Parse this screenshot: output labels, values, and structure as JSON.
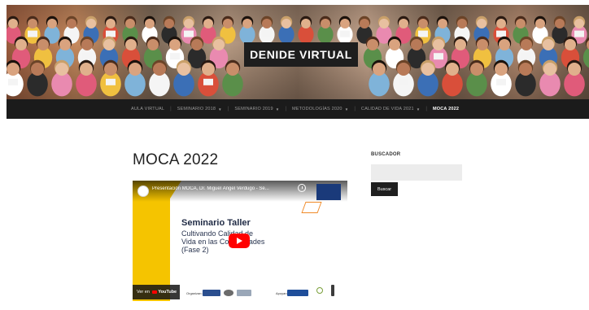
{
  "header": {
    "site_title": "DENIDE VIRTUAL"
  },
  "nav": {
    "items": [
      {
        "label": "AULA VIRTUAL",
        "has_dropdown": false,
        "active": false
      },
      {
        "label": "SEMINARIO 2018",
        "has_dropdown": true,
        "active": false
      },
      {
        "label": "SEMINARIO 2019",
        "has_dropdown": true,
        "active": false
      },
      {
        "label": "METODOLOGÍAS 2020",
        "has_dropdown": true,
        "active": false
      },
      {
        "label": "CALIDAD DE VIDA 2021",
        "has_dropdown": true,
        "active": false
      },
      {
        "label": "MOCA 2022",
        "has_dropdown": false,
        "active": true
      }
    ],
    "caret_icon": "chevron-down-icon"
  },
  "main": {
    "page_title": "MOCA 2022",
    "video": {
      "title": "Presentación MOCA, Dr. Miguel Ángel Verdugo - Se...",
      "heading": "Seminario Taller",
      "subtitle_lines": [
        "Cultivando Calidad de",
        "Vida en las Comunidades",
        "(Fase 2)"
      ],
      "watch_on_label": "Ver en",
      "youtube_label": "YouTube",
      "organiza_label": "Organizan:",
      "apoyo_label": "Apoyan:",
      "accent_color": "#f5c400",
      "play_color": "#ff0000"
    }
  },
  "sidebar": {
    "search_title": "BUSCADOR",
    "search_placeholder": "",
    "search_button_label": "Buscar"
  }
}
